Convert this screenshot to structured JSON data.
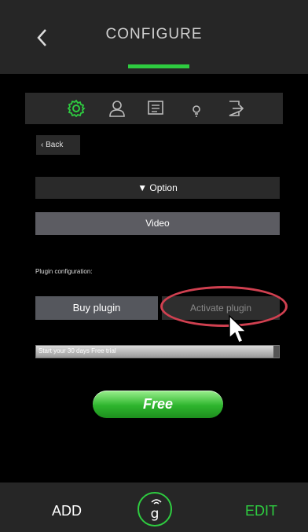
{
  "header": {
    "title": "CONFIGURE"
  },
  "icon_bar": {
    "items": [
      {
        "icon": "gear-icon",
        "active": true
      },
      {
        "icon": "user-icon",
        "active": false
      },
      {
        "icon": "list-icon",
        "active": false
      },
      {
        "icon": "lightbulb-icon",
        "active": false
      },
      {
        "icon": "exit-icon",
        "active": false
      }
    ],
    "active_color": "#2ecc40"
  },
  "back_button": {
    "label": "Back"
  },
  "option_bar": {
    "label": "▼ Option"
  },
  "video_bar": {
    "label": "Video"
  },
  "plugin": {
    "label": "Plugin configuration:",
    "buy_label": "Buy plugin",
    "activate_label": "Activate plugin",
    "trial_text": "Start your 30 days Free trial",
    "free_label": "Free"
  },
  "bottom_bar": {
    "add_label": "ADD",
    "edit_label": "EDIT",
    "logo_letter": "g"
  },
  "colors": {
    "accent": "#2ecc40",
    "highlight": "#d04050",
    "background": "#000000",
    "bar": "#262626"
  }
}
